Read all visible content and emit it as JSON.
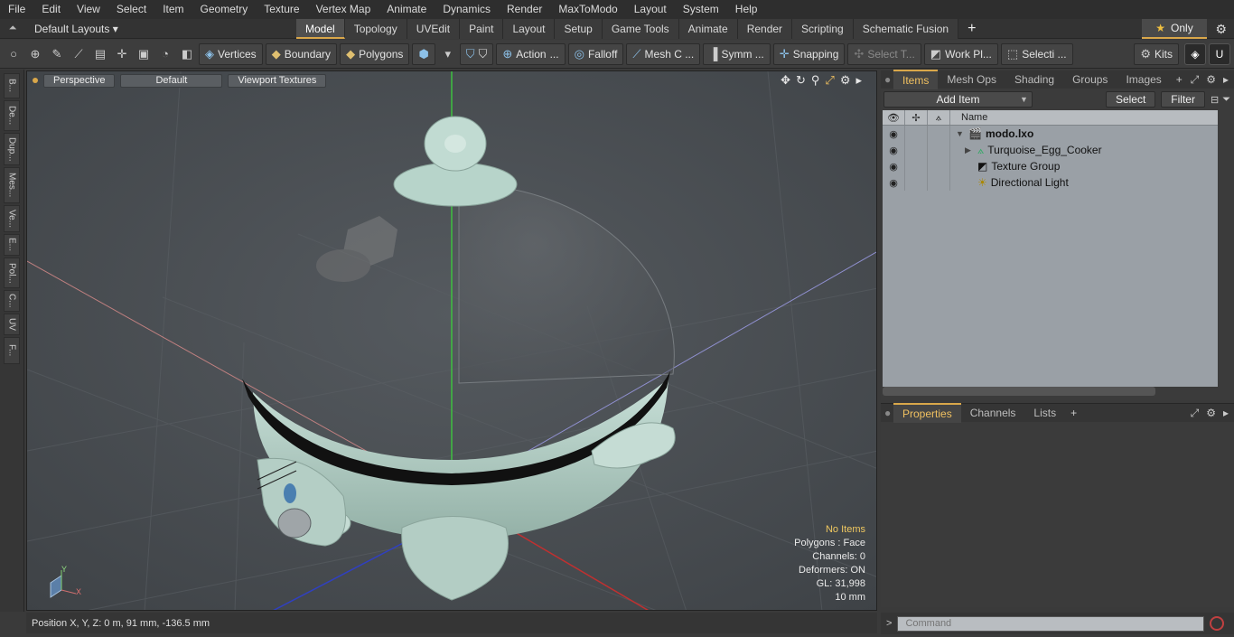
{
  "menu": [
    "File",
    "Edit",
    "View",
    "Select",
    "Item",
    "Geometry",
    "Texture",
    "Vertex Map",
    "Animate",
    "Dynamics",
    "Render",
    "MaxToModo",
    "Layout",
    "System",
    "Help"
  ],
  "layouts": {
    "label": "Default Layouts ▾"
  },
  "layout_tabs": [
    "Model",
    "Topology",
    "UVEdit",
    "Paint",
    "Layout",
    "Setup",
    "Game Tools",
    "Animate",
    "Render",
    "Scripting",
    "Schematic Fusion"
  ],
  "active_layout_tab": "Model",
  "only": {
    "label": "Only",
    "star": "★"
  },
  "toolbar": {
    "vertices": "Vertices",
    "boundary": "Boundary",
    "polygons": "Polygons",
    "action": "Action",
    "action_more": "...",
    "falloff": "Falloff",
    "mesh": "Mesh C ...",
    "symm": "Symm ...",
    "snapping": "Snapping",
    "select_t": "Select T...",
    "work_pl": "Work Pl...",
    "selecti": "Selecti ...",
    "kits": "Kits"
  },
  "left_tabs": [
    "B...",
    "De...",
    "Dup...",
    "Mes...",
    "Ve...",
    "E...",
    "Pol...",
    "C...",
    "UV",
    "F..."
  ],
  "viewport": {
    "perspective": "Perspective",
    "default": "Default",
    "textures": "Viewport Textures",
    "info": {
      "no_items": "No Items",
      "polygons": "Polygons : Face",
      "channels": "Channels: 0",
      "deformers": "Deformers: ON",
      "gl": "GL: 31,998",
      "scale": "10 mm"
    },
    "axis_y": "Y",
    "axis_x": "X"
  },
  "status": {
    "position": "Position X, Y, Z:   0 m, 91 mm, -136.5 mm"
  },
  "items_panel": {
    "tabs": [
      "Items",
      "Mesh Ops",
      "Shading",
      "Groups",
      "Images"
    ],
    "active_tab": "Items",
    "add_item": "Add Item",
    "select": "Select",
    "filter": "Filter",
    "column_name": "Name",
    "rows": [
      {
        "label": "modo.lxo",
        "bold": true,
        "icon": "scene-icon"
      },
      {
        "label": "Turquoise_Egg_Cooker",
        "bold": false,
        "icon": "mesh-icon"
      },
      {
        "label": "Texture Group",
        "bold": false,
        "icon": "texture-group-icon"
      },
      {
        "label": "Directional Light",
        "bold": false,
        "icon": "light-icon"
      }
    ]
  },
  "properties_panel": {
    "tabs": [
      "Properties",
      "Channels",
      "Lists"
    ],
    "active_tab": "Properties"
  },
  "command": {
    "placeholder": "Command"
  },
  "colors": {
    "accent": "#d9a74a",
    "viewport_bg": "#484d52",
    "model": "#b9d6cc"
  }
}
